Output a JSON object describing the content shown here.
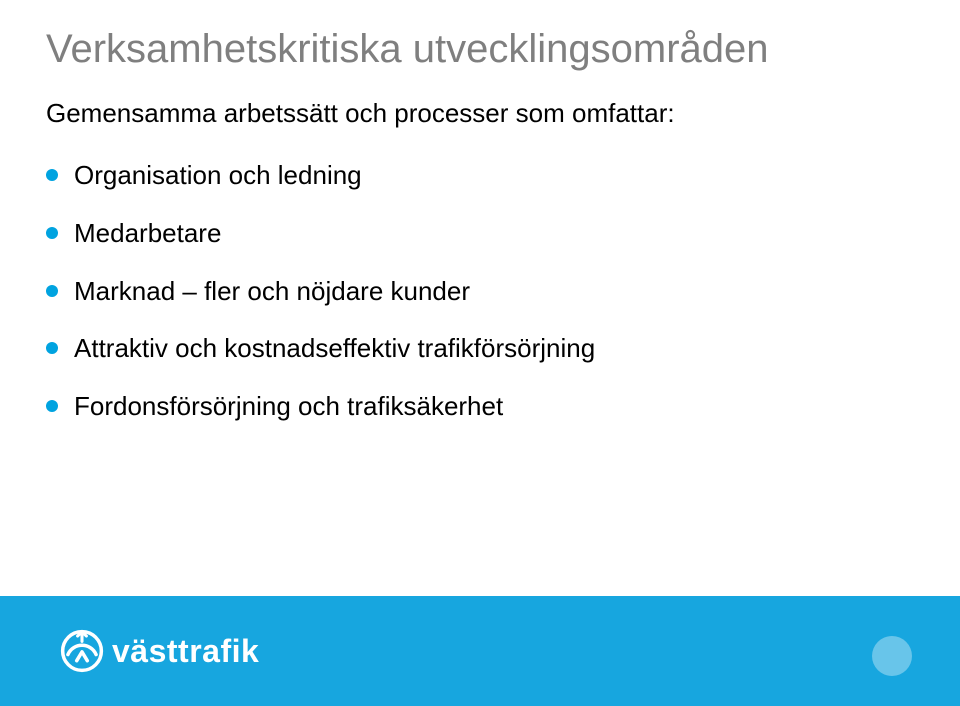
{
  "title": "Verksamhetskritiska utvecklingsområden",
  "subtitle": "Gemensamma arbetssätt och processer som omfattar:",
  "bullets": [
    "Organisation och ledning",
    "Medarbetare",
    "Marknad – fler och nöjdare kunder",
    "Attraktiv och kostnadseffektiv trafikförsörjning",
    "Fordonsförsörjning och trafiksäkerhet"
  ],
  "brand": {
    "name": "västtrafik",
    "accent": "#17a6df"
  }
}
